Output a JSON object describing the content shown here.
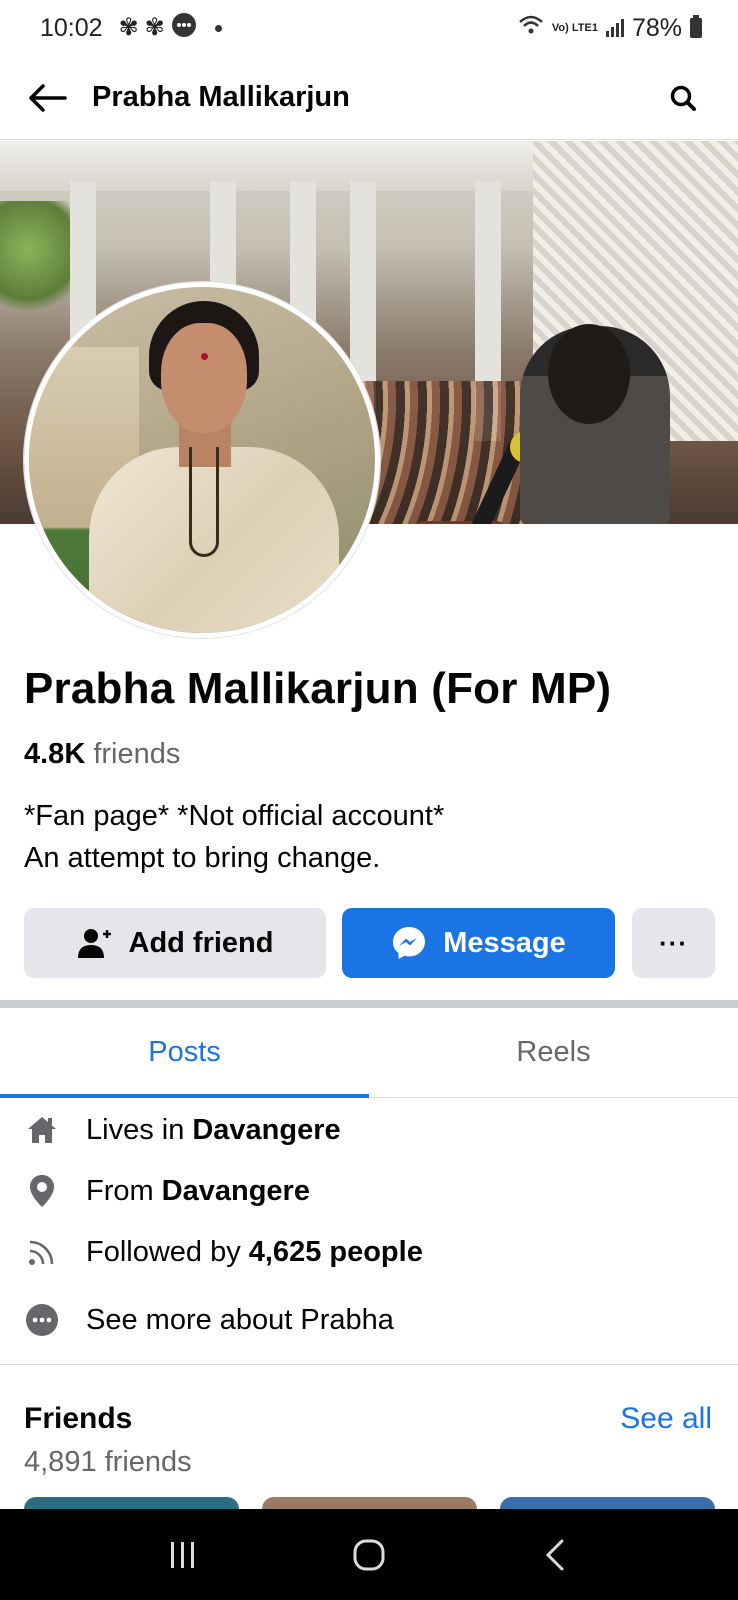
{
  "status_bar": {
    "time": "10:02",
    "network_label": "Vo) LTE1",
    "battery": "78%"
  },
  "header": {
    "title": "Prabha Mallikarjun"
  },
  "profile": {
    "name": "Prabha Mallikarjun (For MP)",
    "friends_count": "4.8K",
    "friends_label": "friends",
    "bio_line1": "*Fan page* *Not official account*",
    "bio_line2": "An attempt to bring change."
  },
  "actions": {
    "add_friend": "Add friend",
    "message": "Message",
    "more": "···"
  },
  "tabs": [
    {
      "label": "Posts",
      "active": true
    },
    {
      "label": "Reels",
      "active": false
    }
  ],
  "about": {
    "lives_prefix": "Lives in",
    "lives_value": "Davangere",
    "from_prefix": "From",
    "from_value": "Davangere",
    "followed_prefix": "Followed by",
    "followed_value": "4,625 people",
    "see_more": "See more about Prabha"
  },
  "friends": {
    "heading": "Friends",
    "see_all": "See all",
    "total": "4,891 friends"
  },
  "icons": {
    "back": "arrow-left-icon",
    "search": "search-icon",
    "add_friend": "person-add-icon",
    "messenger": "messenger-icon",
    "home": "home-icon",
    "location": "location-pin-icon",
    "rss": "rss-icon",
    "more": "more-dots-icon"
  },
  "colors": {
    "accent": "#1b74e4",
    "secondary_button": "#e4e6eb",
    "muted_text": "#65676b",
    "primary_text": "#050505"
  }
}
